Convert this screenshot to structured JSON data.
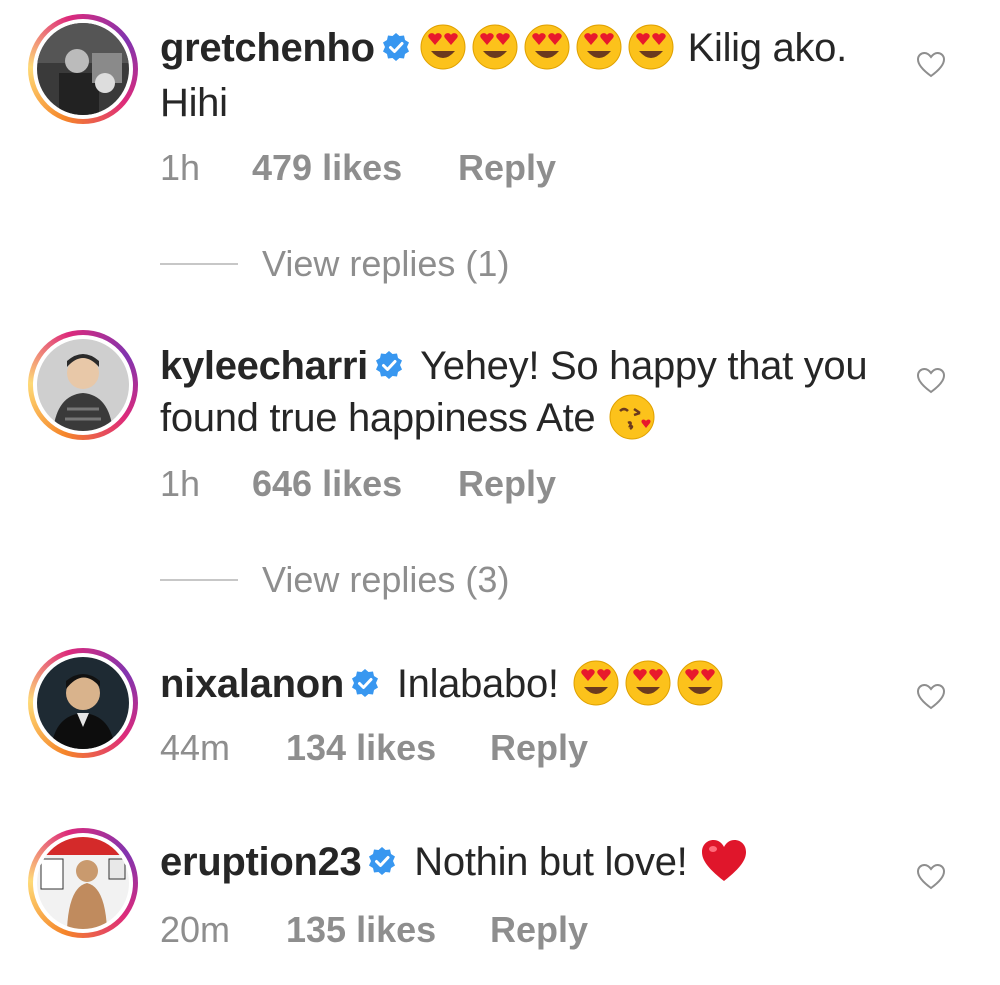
{
  "comments": [
    {
      "username": "gretchenho",
      "text_before": "",
      "text_after": " Kilig ako. Hihi",
      "emojis_before": [
        "heart-eyes",
        "heart-eyes",
        "heart-eyes",
        "heart-eyes",
        "heart-eyes"
      ],
      "time": "1h",
      "likes": "479 likes",
      "reply": "Reply",
      "view_replies": "View replies (1)"
    },
    {
      "username": "kyleecharri",
      "text": " Yehey! So happy that you found true happiness Ate ",
      "emoji_after": "kissing-heart",
      "time": "1h",
      "likes": "646 likes",
      "reply": "Reply",
      "view_replies": "View replies (3)"
    },
    {
      "username": "nixalanon",
      "text": " Inlababo! ",
      "emojis_after": [
        "heart-eyes",
        "heart-eyes",
        "heart-eyes"
      ],
      "time": "44m",
      "likes": "134 likes",
      "reply": "Reply"
    },
    {
      "username": "eruption23",
      "text": " Nothin but love! ",
      "emoji_after": "red-heart",
      "time": "20m",
      "likes": "135 likes",
      "reply": "Reply"
    }
  ],
  "colors": {
    "text": "#262626",
    "meta": "#8e8e8e",
    "verified": "#3897f0",
    "divider": "#c7c7c7"
  },
  "icons": {
    "like": "heart-outline-icon",
    "verified": "verified-badge-icon"
  }
}
